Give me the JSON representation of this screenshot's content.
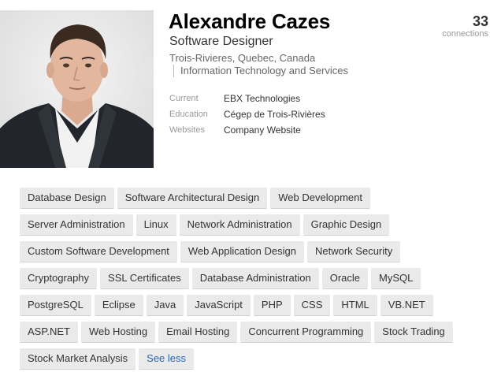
{
  "profile": {
    "name": "Alexandre Cazes",
    "headline": "Software Designer",
    "location": "Trois-Rivieres, Quebec, Canada",
    "industry": "Information Technology and Services",
    "connections_count": "33",
    "connections_label": "connections",
    "photo_icon": "profile-photo"
  },
  "details": {
    "current_label": "Current",
    "current_value": "EBX Technologies",
    "education_label": "Education",
    "education_value": "Cégep de Trois-Rivières",
    "websites_label": "Websites",
    "websites_value": "Company Website"
  },
  "skills": {
    "rows": [
      [
        "Database Design",
        "Software Architectural Design",
        "Web Development"
      ],
      [
        "Server Administration",
        "Linux",
        "Network Administration",
        "Graphic Design"
      ],
      [
        "Custom Software Development",
        "Web Application Design",
        "Network Security"
      ],
      [
        "Cryptography",
        "SSL Certificates",
        "Database Administration",
        "Oracle",
        "MySQL"
      ],
      [
        "PostgreSQL",
        "Eclipse",
        "Java",
        "JavaScript",
        "PHP",
        "CSS",
        "HTML",
        "VB.NET"
      ],
      [
        "ASP.NET",
        "Web Hosting",
        "Email Hosting",
        "Concurrent Programming",
        "Stock Trading"
      ],
      [
        "Stock Market Analysis"
      ]
    ],
    "see_less_label": "See less"
  },
  "colors": {
    "link": "#2867b2",
    "pill_background": "#eaeaea"
  }
}
